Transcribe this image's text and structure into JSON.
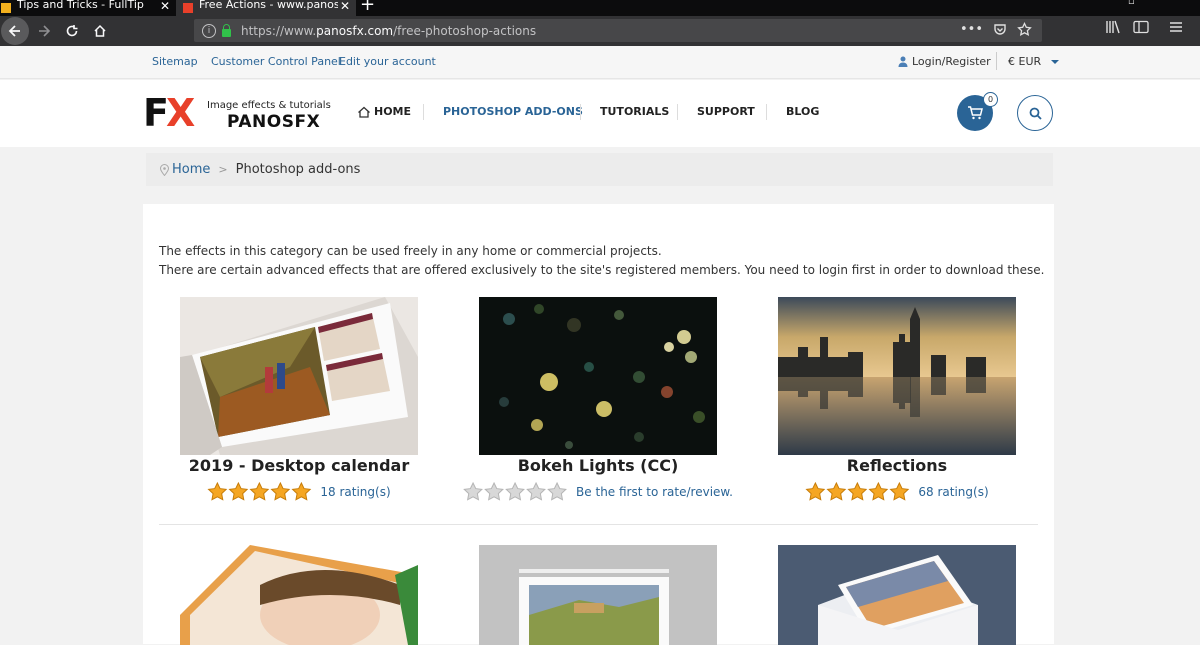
{
  "browser": {
    "tabs": [
      {
        "title": "Tips and Tricks - FullTip",
        "close": "✕"
      },
      {
        "title": "Free Actions - www.panosfx.com",
        "close": "✕"
      }
    ],
    "new_tab": "+",
    "url_prefix": "https://www.",
    "url_domain": "panosfx.com",
    "url_path": "/free-photoshop-actions",
    "url_menu": "•••"
  },
  "topbar": {
    "links": [
      "Sitemap",
      "Customer Control Panel",
      "Edit your account"
    ],
    "login": "Login/Register",
    "currency": "€ EUR"
  },
  "logo": {
    "mark_f": "F",
    "mark_x": "X",
    "tagline": "Image effects & tutorials",
    "name": "PANOSFX"
  },
  "nav": {
    "items": [
      "HOME",
      "PHOTOSHOP ADD-ONS",
      "TUTORIALS",
      "SUPPORT",
      "BLOG"
    ],
    "active": "PHOTOSHOP ADD-ONS"
  },
  "cart": {
    "count": "0"
  },
  "breadcrumb": {
    "home": "Home",
    "separator": ">",
    "current": "Photoshop add-ons"
  },
  "intro": {
    "line1": "The effects in this category can be used freely in any home or commercial projects.",
    "line2": "There are certain advanced effects that are offered exclusively to the site's registered members. You need to login first in order to download these."
  },
  "products": [
    {
      "title": "2019 - Desktop calendar",
      "stars": 5,
      "rating_text": "18 rating(s)"
    },
    {
      "title": "Bokeh Lights (CC)",
      "stars": 0,
      "rating_text": "Be the first to rate/review."
    },
    {
      "title": "Reflections",
      "stars": 5,
      "rating_text": "68 rating(s)"
    }
  ],
  "colors": {
    "accent": "#2a6496",
    "star_fill": "#f5a623",
    "star_empty": "#d8d8d8",
    "logo_x": "#e8402a"
  }
}
